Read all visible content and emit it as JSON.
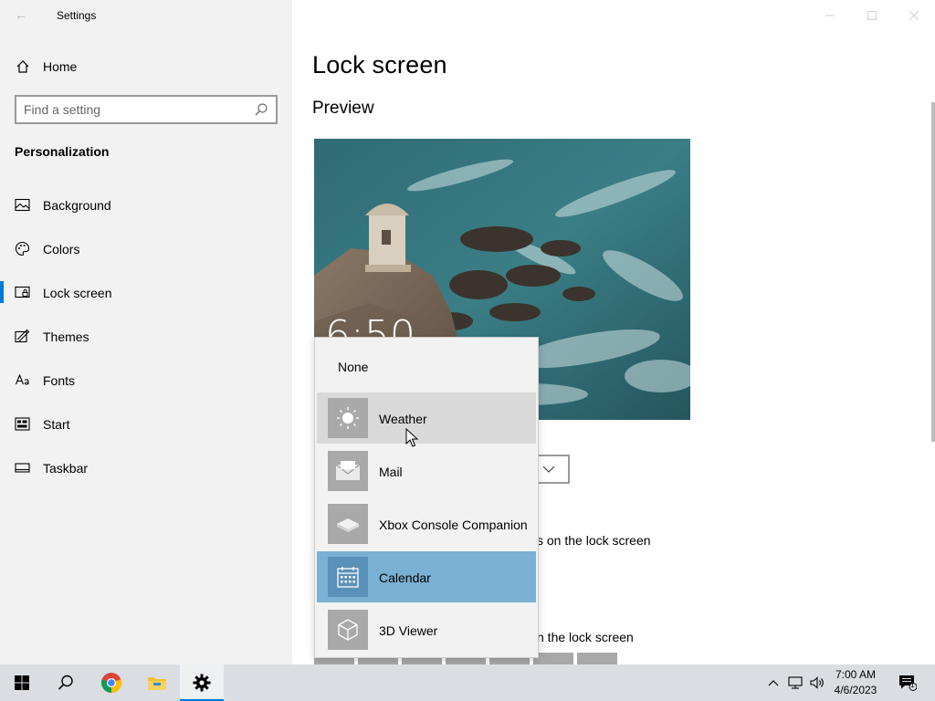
{
  "window": {
    "title": "Settings"
  },
  "sidebar": {
    "home_label": "Home",
    "search_placeholder": "Find a setting",
    "section_title": "Personalization",
    "items": [
      {
        "label": "Background",
        "icon": "image-icon"
      },
      {
        "label": "Colors",
        "icon": "palette-icon"
      },
      {
        "label": "Lock screen",
        "icon": "lock-screen-icon",
        "selected": true
      },
      {
        "label": "Themes",
        "icon": "themes-icon"
      },
      {
        "label": "Fonts",
        "icon": "fonts-icon"
      },
      {
        "label": "Start",
        "icon": "start-icon"
      },
      {
        "label": "Taskbar",
        "icon": "taskbar-icon"
      }
    ]
  },
  "main": {
    "page_title": "Lock screen",
    "preview_title": "Preview",
    "preview_clock": "6:50",
    "peek_text_1": "s on the lock screen",
    "peek_text_2": "n the lock screen"
  },
  "flyout": {
    "none_label": "None",
    "items": [
      {
        "label": "Weather",
        "icon": "weather-icon",
        "state": "hover"
      },
      {
        "label": "Mail",
        "icon": "mail-icon",
        "state": "normal"
      },
      {
        "label": "Xbox Console Companion",
        "icon": "xbox-icon",
        "state": "normal"
      },
      {
        "label": "Calendar",
        "icon": "calendar-icon",
        "state": "selected"
      },
      {
        "label": "3D Viewer",
        "icon": "3d-viewer-icon",
        "state": "normal"
      }
    ]
  },
  "taskbar": {
    "time": "7:00 AM",
    "date": "4/6/2023",
    "notification_count": "1",
    "accent_color": "#0078d7"
  }
}
